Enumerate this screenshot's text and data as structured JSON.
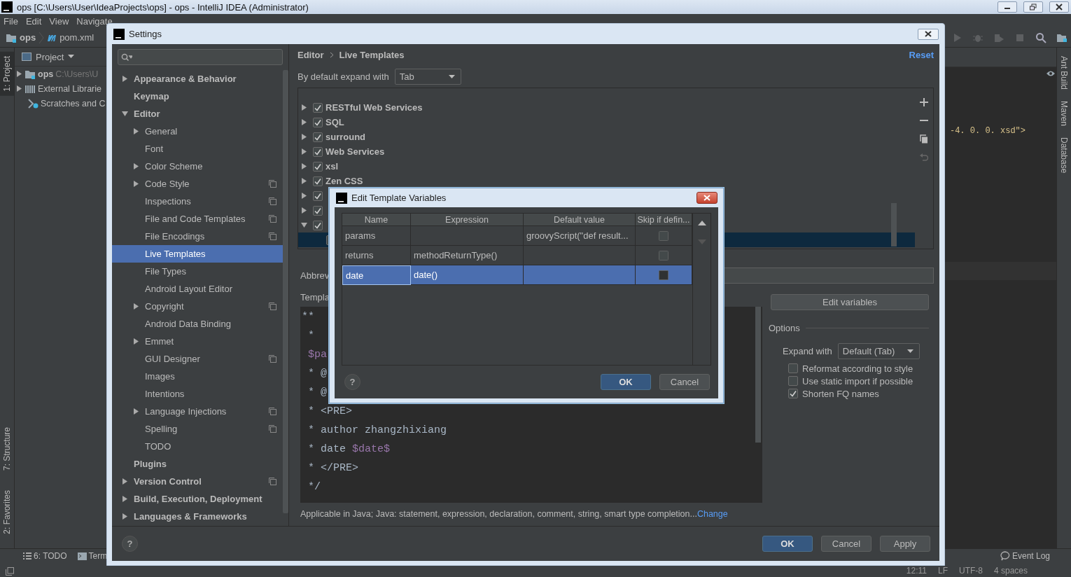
{
  "ide": {
    "title": "ops [C:\\Users\\User\\IdeaProjects\\ops] - ops - IntelliJ IDEA (Administrator)",
    "menu": [
      "File",
      "Edit",
      "View",
      "Navigate"
    ],
    "breadcrumb": [
      "ops",
      "pom.xml"
    ],
    "left_tool_tabs": [
      {
        "label": "1: Project",
        "selected": true
      },
      {
        "label": "7: Structure",
        "selected": false
      },
      {
        "label": "2: Favorites",
        "selected": false
      }
    ],
    "project_panel": {
      "title": "Project",
      "items": [
        {
          "kind": "module",
          "label": "ops",
          "path": "C:\\Users\\U"
        },
        {
          "kind": "library",
          "label": "External Librarie"
        },
        {
          "kind": "scratches",
          "label": "Scratches and C"
        }
      ]
    },
    "editor_text": "-4. 0. 0. xsd\">",
    "right_tool_tabs": [
      "Ant Build",
      "Maven",
      "Database"
    ],
    "bottom_tabs": [
      "6: TODO",
      "Term"
    ],
    "event_log": "Event Log",
    "status_bar": [
      "12:11",
      "LF",
      "UTF-8",
      "4 spaces"
    ]
  },
  "settings": {
    "title": "Settings",
    "tree": [
      {
        "label": "Appearance & Behavior",
        "expandable": true,
        "expanded": false,
        "selected": false
      },
      {
        "label": "Keymap",
        "selected": false
      },
      {
        "label": "Editor",
        "expandable": true,
        "expanded": true,
        "selected": false,
        "children": [
          {
            "label": "General",
            "expandable": true,
            "expanded": false,
            "selected": false
          },
          {
            "label": "Font",
            "selected": false
          },
          {
            "label": "Color Scheme",
            "expandable": true,
            "expanded": false,
            "selected": false
          },
          {
            "label": "Code Style",
            "expandable": true,
            "expanded": false,
            "project_level": true,
            "selected": false
          },
          {
            "label": "Inspections",
            "project_level": true,
            "selected": false
          },
          {
            "label": "File and Code Templates",
            "project_level": true,
            "selected": false
          },
          {
            "label": "File Encodings",
            "project_level": true,
            "selected": false
          },
          {
            "label": "Live Templates",
            "selected": true
          },
          {
            "label": "File Types",
            "selected": false
          },
          {
            "label": "Android Layout Editor",
            "selected": false
          },
          {
            "label": "Copyright",
            "expandable": true,
            "expanded": false,
            "project_level": true,
            "selected": false
          },
          {
            "label": "Android Data Binding",
            "selected": false
          },
          {
            "label": "Emmet",
            "expandable": true,
            "expanded": false,
            "selected": false
          },
          {
            "label": "GUI Designer",
            "project_level": true,
            "selected": false
          },
          {
            "label": "Images",
            "selected": false
          },
          {
            "label": "Intentions",
            "selected": false
          },
          {
            "label": "Language Injections",
            "expandable": true,
            "expanded": false,
            "project_level": true,
            "selected": false
          },
          {
            "label": "Spelling",
            "project_level": true,
            "selected": false
          },
          {
            "label": "TODO",
            "selected": false
          }
        ]
      },
      {
        "label": "Plugins",
        "selected": false
      },
      {
        "label": "Version Control",
        "expandable": true,
        "expanded": false,
        "project_level": true,
        "selected": false
      },
      {
        "label": "Build, Execution, Deployment",
        "expandable": true,
        "expanded": false,
        "selected": false
      },
      {
        "label": "Languages & Frameworks",
        "expandable": true,
        "expanded": false,
        "selected": false
      }
    ],
    "breadcrumb": [
      "Editor",
      "Live Templates"
    ],
    "reset": "Reset",
    "expand_label": "By default expand with",
    "expand_value": "Tab",
    "groups": [
      {
        "label": "RESTful Web Services",
        "checked": true,
        "expanded": false
      },
      {
        "label": "SQL",
        "checked": true,
        "expanded": false
      },
      {
        "label": "surround",
        "checked": true,
        "expanded": false
      },
      {
        "label": "Web Services",
        "checked": true,
        "expanded": false
      },
      {
        "label": "xsl",
        "checked": true,
        "expanded": false
      },
      {
        "label": "Zen CSS",
        "checked": true,
        "expanded": false
      },
      {
        "checked": true,
        "expanded": false
      },
      {
        "checked": true,
        "expanded": false
      },
      {
        "checked": true,
        "expanded": true,
        "children": [
          {
            "selected": true
          }
        ]
      }
    ],
    "abbreviation_label": "Abbrev",
    "template_label": "Templa",
    "template_text": [
      [
        {
          "text": "**",
          "variable": false
        }
      ],
      [
        {
          "text": " *",
          "variable": false
        }
      ],
      [
        {
          "text": " $pa",
          "variable": true
        }
      ],
      [
        {
          "text": " * @",
          "variable": false
        }
      ],
      [
        {
          "text": " * @",
          "variable": false
        }
      ],
      [
        {
          "text": " * <PRE>",
          "variable": false
        }
      ],
      [
        {
          "text": " * author zhangzhixiang",
          "variable": false
        }
      ],
      [
        {
          "text": " * date ",
          "variable": false
        },
        {
          "text": "$date$",
          "variable": true
        }
      ],
      [
        {
          "text": " * </PRE>",
          "variable": false
        }
      ],
      [
        {
          "text": " */",
          "variable": false
        }
      ]
    ],
    "edit_variables": "Edit variables",
    "options": {
      "title": "Options",
      "expand_label": "Expand with",
      "expand_value": "Default (Tab)",
      "checkboxes": [
        {
          "label": "Reformat according to style",
          "checked": false
        },
        {
          "label": "Use static import if possible",
          "checked": false
        },
        {
          "label": "Shorten FQ names",
          "checked": true
        }
      ]
    },
    "applicable": "Applicable in Java; Java: statement, expression, declaration, comment, string, smart type completion...",
    "change_link": "Change",
    "help": "?",
    "buttons": [
      {
        "label": "OK",
        "kind": "default"
      },
      {
        "label": "Cancel",
        "kind": "normal"
      },
      {
        "label": "Apply",
        "kind": "normal"
      }
    ]
  },
  "edit_variables_dialog": {
    "title": "Edit Template Variables",
    "columns": [
      "Name",
      "Expression",
      "Default value",
      "Skip if defin..."
    ],
    "rows": [
      {
        "name": "params",
        "default_value": "groovyScript(\"def result...",
        "skip_if_defined": false,
        "selected": false
      },
      {
        "name": "returns",
        "expression": "methodReturnType()",
        "skip_if_defined": false,
        "selected": false
      },
      {
        "name": "date",
        "expression": "date()",
        "skip_if_defined": false,
        "selected": true
      }
    ],
    "help": "?",
    "buttons": [
      {
        "label": "OK",
        "kind": "default"
      },
      {
        "label": "Cancel",
        "kind": "normal"
      }
    ]
  }
}
